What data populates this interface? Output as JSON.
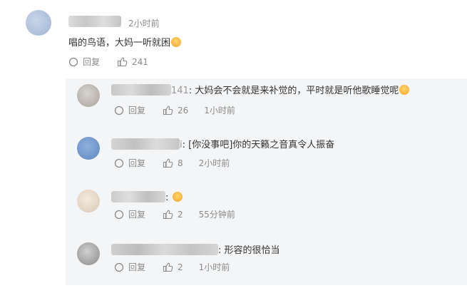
{
  "main_comment": {
    "time": "2小时前",
    "text": "唱的鸟语，大妈一听就困",
    "emoji": "sleepy-emoji",
    "reply_label": "回复",
    "likes": "241"
  },
  "replies": [
    {
      "name_suffix": "141",
      "text": "大妈会不会就是来补觉的，平时就是听他歌睡觉呢",
      "emoji": "laugh-cry-emoji",
      "reply_label": "回复",
      "likes": "26",
      "time": "1小时前"
    },
    {
      "name_suffix": "i",
      "text": "[你没事吧]你的天籁之音真令人振奋",
      "reply_label": "回复",
      "likes": "8",
      "time": "2小时前"
    },
    {
      "name_suffix": "",
      "text": "",
      "emoji": "face-emoji",
      "reply_label": "回复",
      "likes": "2",
      "time": "55分钟前"
    },
    {
      "name_suffix": "",
      "text": "形容的很恰当",
      "reply_label": "回复",
      "likes": "2",
      "time": "1小时前"
    }
  ],
  "colors": {
    "panel_bg": "#f4f5f7",
    "meta": "#8a8a8a",
    "text": "#333333"
  }
}
